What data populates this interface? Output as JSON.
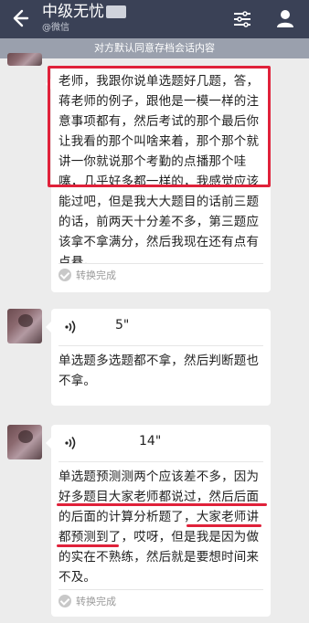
{
  "header": {
    "title": "中级无忧",
    "subtitle": "@微信"
  },
  "notice": "对方默认同意存档会话内容",
  "messages": [
    {
      "type": "text",
      "text": "老师，我跟你说单选题好几题，答，蒋老师的例子，跟他是一模一样的注意事项都有，然后考试的那个最后你让我看的那个叫啥来着，那个那个就讲一你就说那个考勤的点播那个哇噻，几乎好多都一样的，我感觉应该能过吧，但是我大大题目的话前三题的话，前两天十分差不多，第三题应该拿不拿满分，然后我现在还有点有点悬。",
      "status": "转换完成"
    },
    {
      "type": "voice",
      "duration": "5\"",
      "text": "单选题多选题都不拿，然后判断题也不拿。"
    },
    {
      "type": "voice",
      "duration": "14\"",
      "text": "单选题预测测两个应该差不多，因为好多题目大家老师都说过，然后后面的后面的计算分析题了，大家老师讲都预测到了，哎呀，但是我是因为做的实在不熟练，然后就是要想时间来不及。",
      "status": "转换完成"
    }
  ],
  "accent_colors": {
    "header_bg": "#3a4156",
    "highlight": "#e0213a"
  }
}
